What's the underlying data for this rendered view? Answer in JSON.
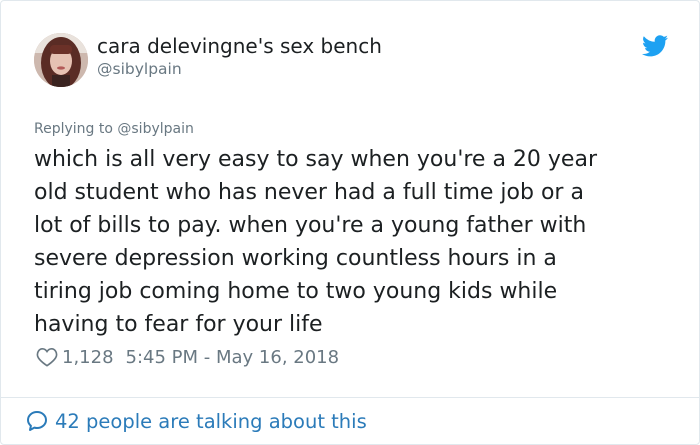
{
  "tweet": {
    "display_name": "cara delevingne's sex bench",
    "handle": "@sibylpain",
    "replying_prefix": "Replying to ",
    "replying_to": "@sibylpain",
    "text": "which is all very easy to say when you're a 20 year\nold student who has never had a full time job or a\nlot of bills to pay. when you're a young father with\nsevere depression working countless hours in a\ntiring job coming home to two young kids while\nhaving to fear for your life",
    "likes": "1,128",
    "timestamp": "5:45 PM - May 16, 2018",
    "talking_text": "42 people are talking about this"
  },
  "icons": {
    "brand": "twitter-bird-icon",
    "like": "heart-icon",
    "conversation": "speech-bubble-icon"
  },
  "colors": {
    "text": "#1c2022",
    "secondary": "#697882",
    "link": "#2b7bb9",
    "twitter_blue": "#1da1f2",
    "border": "#e1e8ed"
  }
}
